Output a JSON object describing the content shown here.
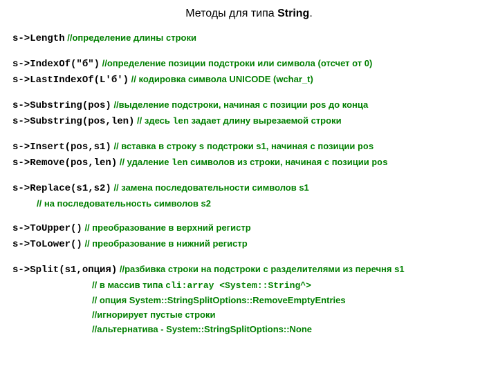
{
  "title_prefix": "Методы для типа ",
  "title_bold": "String",
  "title_suffix": ".",
  "length_code": "s->Length",
  "length_c": " //определение длины строки",
  "indexof_code": "s->IndexOf(\"б\")",
  "indexof_c": " //определение позиции подстроки или символа (отсчет от 0)",
  "lastindexof_code": "s->LastIndexOf(L'б')",
  "lastindexof_c": " // кодировка символа  UNICODE (wchar_t)",
  "substring1_code": "s->Substring(pos)",
  "substring1_c": " //выделение подстроки, начиная с позиции pos до конца",
  "substring2_code": "s->Substring(pos,len)",
  "substring2_c_pre": " // здесь ",
  "substring2_c_mono": "len",
  "substring2_c_post": " задает длину вырезаемой строки",
  "insert_code": "s->Insert(pos,s1)",
  "insert_c_pre": " // вставка в строку ",
  "insert_c_mono1": "s",
  "insert_c_mid": " подстроки s1, начиная с позиции ",
  "insert_c_mono2": "pos",
  "remove_code": "s->Remove(pos,len)",
  "remove_c_pre": " // удаление ",
  "remove_c_mono1": "len",
  "remove_c_mid": " символов из строки, начиная с позиции ",
  "remove_c_mono2": "pos",
  "replace_code": "s->Replace(s1,s2)",
  "replace_c1": " // замена последовательности символов s1",
  "replace_c2": "// на последовательность символов s2",
  "toupper_code": "s->ToUpper()",
  "toupper_c": " // преобразование в верхний регистр",
  "tolower_code": "s->ToLower()",
  "tolower_c": " // преобразование в нижний регистр",
  "split_code": "s->Split(s1,опция)",
  "split_c1": " //разбивка строки на подстроки с разделителями из перечня s1",
  "split_c2_pre": "// в массив типа ",
  "split_c2_mono": "cli:array <System::String^>",
  "split_c3": "// опция System::StringSplitOptions::RemoveEmptyEntries",
  "split_c4": "//игнорирует пустые строки",
  "split_c5": "//альтернатива - System::StringSplitOptions::None"
}
